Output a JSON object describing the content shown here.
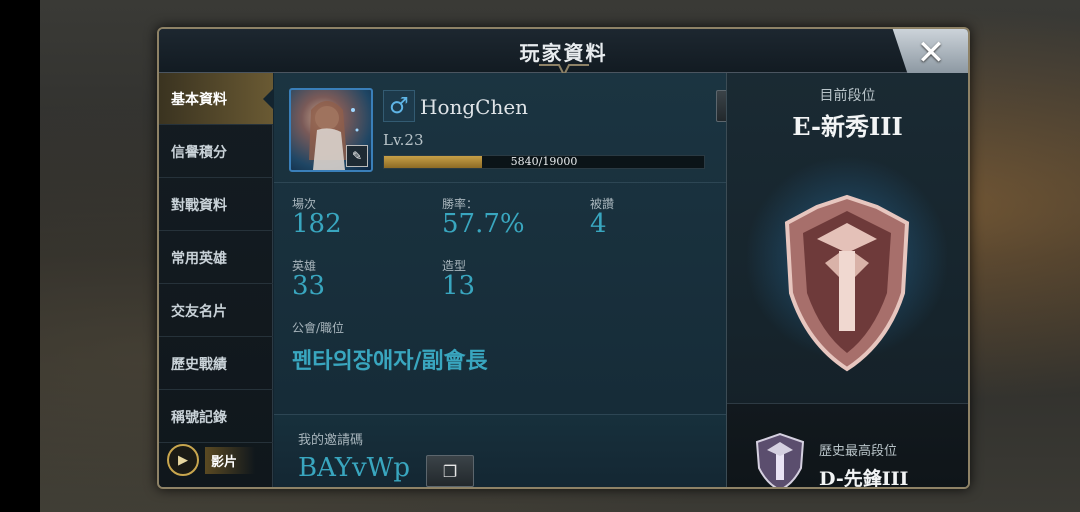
{
  "window": {
    "title": "玩家資料"
  },
  "sidebar": {
    "items": [
      {
        "label": "基本資料",
        "active": true
      },
      {
        "label": "信譽積分",
        "active": false
      },
      {
        "label": "對戰資料",
        "active": false
      },
      {
        "label": "常用英雄",
        "active": false
      },
      {
        "label": "交友名片",
        "active": false
      },
      {
        "label": "歷史戰績",
        "active": false
      },
      {
        "label": "稱號記錄",
        "active": false
      }
    ],
    "video_label": "影片"
  },
  "profile": {
    "gender_symbol": "♂",
    "name": "HongChen",
    "level": "Lv.23",
    "xp_current": 5840,
    "xp_max": 19000,
    "xp_text": "5840/19000"
  },
  "stats": {
    "matches_label": "場次",
    "matches_value": "182",
    "winrate_label": "勝率：",
    "winrate_value": "57.7%",
    "likes_label": "被讚",
    "likes_value": "4",
    "heroes_label": "英雄",
    "heroes_value": "33",
    "skins_label": "造型",
    "skins_value": "13",
    "guild_label": "公會/職位",
    "guild_value": "펜타의장애자/副會長"
  },
  "invite": {
    "label": "我的邀請碼",
    "code": "BAYvWp"
  },
  "rank": {
    "current_label": "目前段位",
    "current_value": "E-新秀III",
    "best_label": "歷史最高段位",
    "best_value": "D-先鋒III"
  },
  "colors": {
    "accent_teal": "#39a6bf",
    "gold": "#c7a047",
    "panel_border": "#8e8266"
  },
  "icons": {
    "close": "close-icon",
    "edit": "pencil-icon",
    "copy": "copy-icon",
    "play": "play-icon",
    "gender": "male-icon"
  }
}
